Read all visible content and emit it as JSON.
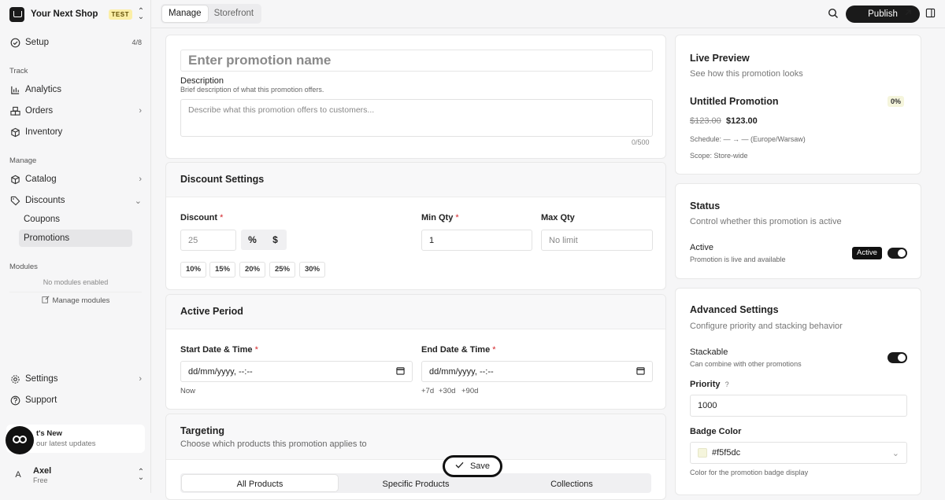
{
  "brand": {
    "name": "Your Next Shop",
    "env_badge": "TEST"
  },
  "sidebar": {
    "setup": {
      "label": "Setup",
      "progress": "4/8"
    },
    "track_label": "Track",
    "track_items": [
      {
        "label": "Analytics"
      },
      {
        "label": "Orders"
      },
      {
        "label": "Inventory"
      }
    ],
    "manage_label": "Manage",
    "catalog": "Catalog",
    "discounts": "Discounts",
    "discount_sub": [
      "Coupons",
      "Promotions"
    ],
    "modules_label": "Modules",
    "no_modules": "No modules enabled",
    "manage_modules": "Manage modules",
    "settings": "Settings",
    "support": "Support",
    "whats_new": {
      "title": "t's New",
      "subtitle": "our latest updates"
    },
    "user": {
      "initial": "A",
      "name": "Axel",
      "plan": "Free"
    }
  },
  "topbar": {
    "tabs": [
      "Manage",
      "Storefront"
    ],
    "publish_label": "Publish"
  },
  "form": {
    "name_placeholder": "Enter promotion name",
    "description_label": "Description",
    "description_hint": "Brief description of what this promotion offers.",
    "description_placeholder": "Describe what this promotion offers to customers...",
    "char_count": "0/500",
    "discount_section": "Discount Settings",
    "discount_label": "Discount",
    "discount_value": "25",
    "discount_types": [
      "%",
      "$"
    ],
    "discount_chips": [
      "10%",
      "15%",
      "20%",
      "25%",
      "30%"
    ],
    "min_qty_label": "Min Qty",
    "min_qty_value": "1",
    "max_qty_label": "Max Qty",
    "max_qty_placeholder": "No limit",
    "period_section": "Active Period",
    "start_label": "Start Date & Time",
    "start_placeholder": "dd/mm/yyyy, --:--",
    "start_quick": "Now",
    "end_label": "End Date & Time",
    "end_placeholder": "dd/mm/yyyy, --:--",
    "end_quick": [
      "+7d",
      "+30d",
      "+90d"
    ],
    "targeting_section": "Targeting",
    "targeting_hint": "Choose which products this promotion applies to",
    "target_tabs": [
      "All Products",
      "Specific Products",
      "Collections"
    ],
    "required_mark": "*"
  },
  "save_label": "Save",
  "preview": {
    "title": "Live Preview",
    "subtitle": "See how this promotion looks",
    "promo_name": "Untitled Promotion",
    "badge": "0%",
    "old_price": "$123.00",
    "new_price": "$123.00",
    "schedule": "Schedule: — → — (Europe/Warsaw)",
    "scope": "Scope: Store-wide"
  },
  "status": {
    "title": "Status",
    "subtitle": "Control whether this promotion is active",
    "active_label": "Active",
    "active_hint": "Promotion is live and available",
    "badge": "Active",
    "enabled": true
  },
  "advanced": {
    "title": "Advanced Settings",
    "subtitle": "Configure priority and stacking behavior",
    "stackable_label": "Stackable",
    "stackable_hint": "Can combine with other promotions",
    "stackable_enabled": true,
    "priority_label": "Priority",
    "priority_help": "?",
    "priority_value": "1000",
    "badge_color_label": "Badge Color",
    "badge_color_value": "#f5f5dc",
    "badge_color_hint": "Color for the promotion badge display"
  },
  "colors": {
    "accent": "#1a1a1a",
    "required": "#d4262b",
    "badge_color": "#f5f5dc",
    "env_badge": "#fbeea6"
  }
}
